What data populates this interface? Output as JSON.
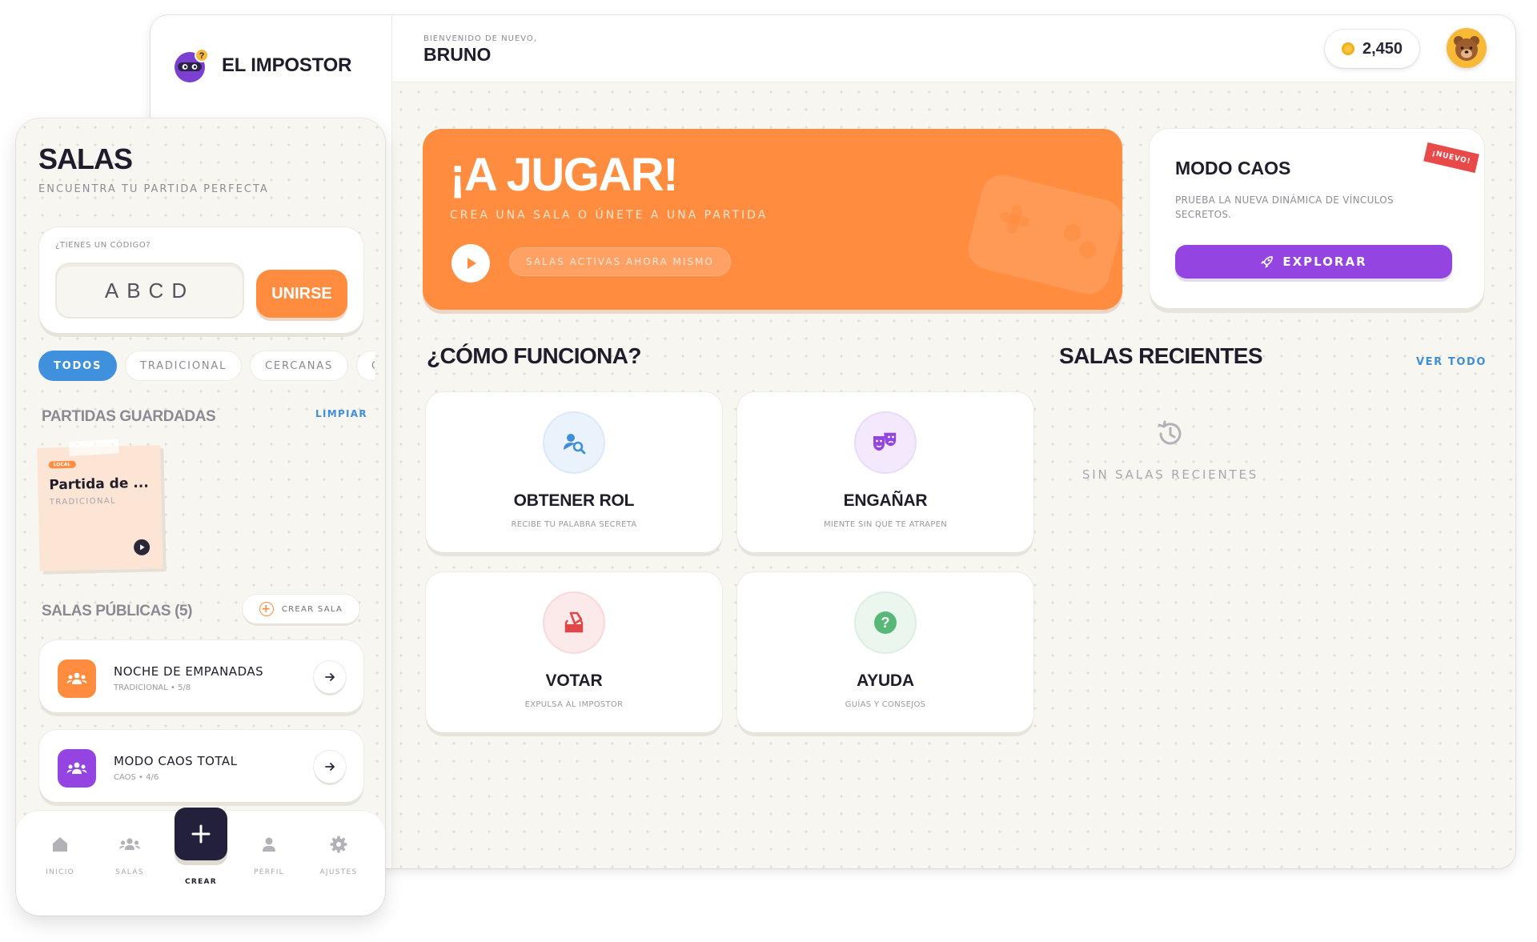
{
  "app": {
    "name": "EL IMPOSTOR"
  },
  "header": {
    "welcome_label": "BIENVENIDO DE NUEVO,",
    "user_name": "BRUNO",
    "coins": "2,450"
  },
  "hero": {
    "title": "¡A JUGAR!",
    "subtitle": "CREA UNA SALA O ÚNETE A UNA PARTIDA",
    "pill": "SALAS ACTIVAS AHORA MISMO",
    "color": "#ff8c3f"
  },
  "caos": {
    "title": "MODO CAOS",
    "description": "PRUEBA LA NUEVA DINÁMICA DE VÍNCULOS SECRETOS.",
    "button": "EXPLORAR",
    "badge": "¡NUEVO!",
    "button_color": "#9444e1"
  },
  "how": {
    "title": "¿CÓMO FUNCIONA?",
    "cards": [
      {
        "title": "OBTENER ROL",
        "subtitle": "RECIBE TU PALABRA SECRETA",
        "icon": "user-search-icon"
      },
      {
        "title": "ENGAÑAR",
        "subtitle": "MIENTE SIN QUE TE ATRAPEN",
        "icon": "masks-icon"
      },
      {
        "title": "VOTAR",
        "subtitle": "EXPULSA AL IMPOSTOR",
        "icon": "ballot-box-icon"
      },
      {
        "title": "AYUDA",
        "subtitle": "GUÍAS Y CONSEJOS",
        "icon": "help-icon"
      }
    ]
  },
  "recent": {
    "title": "SALAS RECIENTES",
    "see_all": "VER TODO",
    "empty": "SIN SALAS RECIENTES"
  },
  "mobile": {
    "title": "SALAS",
    "subtitle": "ENCUENTRA TU PARTIDA PERFECTA",
    "code_label": "¿TIENES UN CÓDIGO?",
    "code_placeholder": "ABCD",
    "join": "UNIRSE",
    "filters": [
      "TODOS",
      "TRADICIONAL",
      "CERCANAS",
      "CAOS"
    ],
    "saved_title": "PARTIDAS GUARDADAS",
    "clear": "LIMPIAR",
    "saved": {
      "tag": "LOCAL",
      "name": "Partida de ...",
      "mode": "TRADICIONAL"
    },
    "public_title": "SALAS PÚBLICAS (5)",
    "create_room": "CREAR SALA",
    "rooms": [
      {
        "name": "NOCHE DE EMPANADAS",
        "meta": "TRADICIONAL • 5/8",
        "color": "#ff8c3f"
      },
      {
        "name": "MODO CAOS TOTAL",
        "meta": "CAOS • 4/6",
        "color": "#9444e1"
      }
    ],
    "nav": [
      {
        "label": "INICIO",
        "icon": "home-icon"
      },
      {
        "label": "SALAS",
        "icon": "group-icon"
      },
      {
        "label": "CREAR",
        "icon": "plus-icon"
      },
      {
        "label": "PERFIL",
        "icon": "person-icon"
      },
      {
        "label": "AJUSTES",
        "icon": "gear-icon"
      }
    ]
  }
}
